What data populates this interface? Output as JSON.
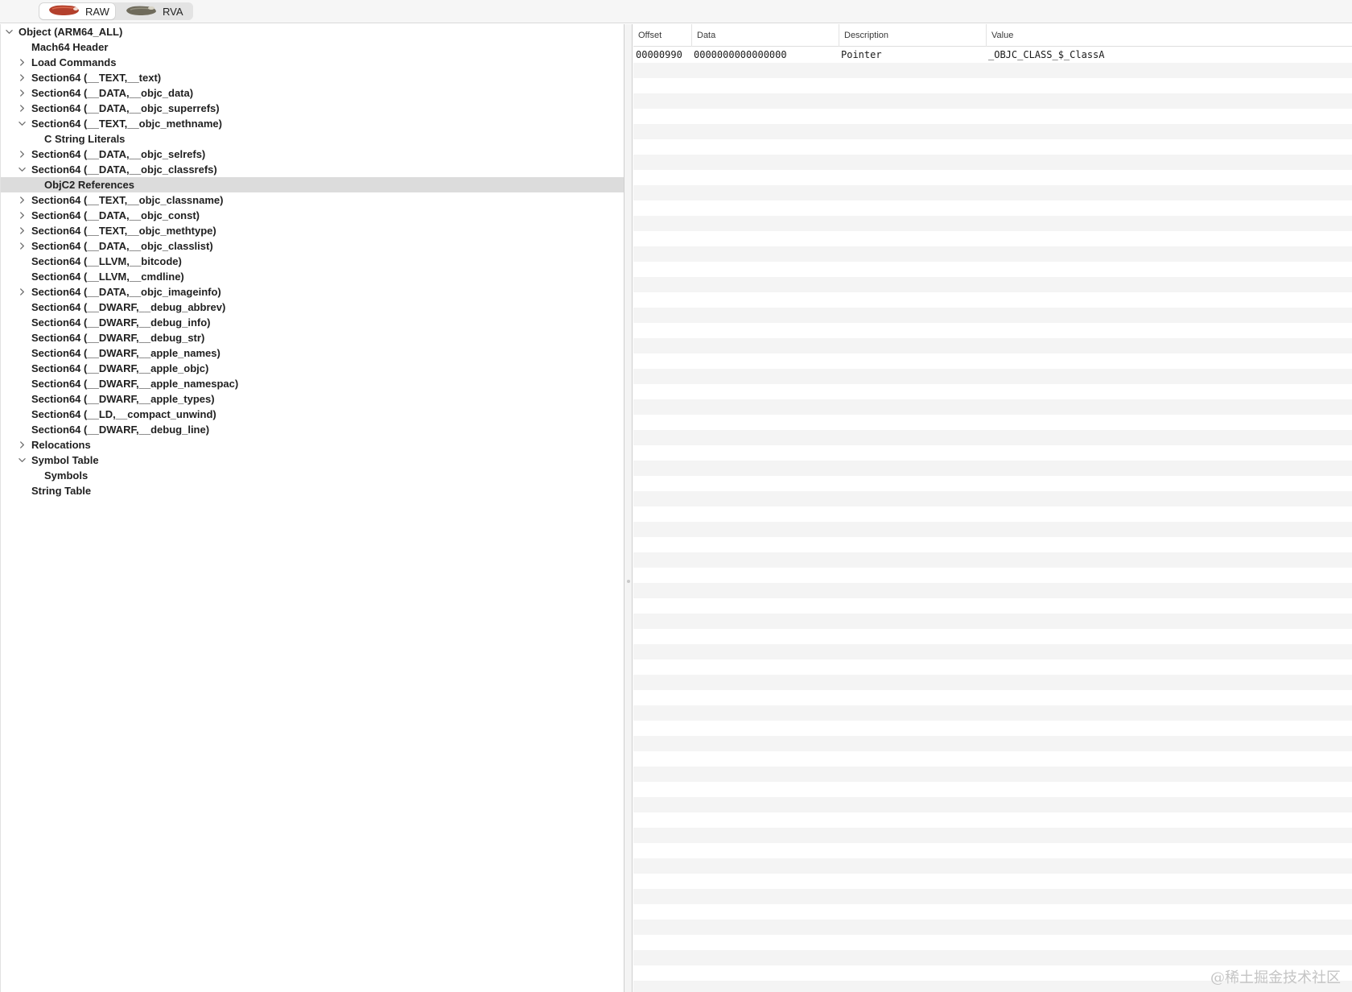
{
  "toolbar": {
    "segments": [
      {
        "label": "RAW",
        "active": true,
        "icon": "raw-icon"
      },
      {
        "label": "RVA",
        "active": false,
        "icon": "rva-icon"
      }
    ]
  },
  "tree": [
    {
      "label": "Object  (ARM64_ALL)",
      "depth": 0,
      "state": "expanded"
    },
    {
      "label": "Mach64 Header",
      "depth": 1,
      "state": "leaf"
    },
    {
      "label": "Load Commands",
      "depth": 1,
      "state": "collapsed"
    },
    {
      "label": "Section64 (__TEXT,__text)",
      "depth": 1,
      "state": "collapsed"
    },
    {
      "label": "Section64 (__DATA,__objc_data)",
      "depth": 1,
      "state": "collapsed"
    },
    {
      "label": "Section64 (__DATA,__objc_superrefs)",
      "depth": 1,
      "state": "collapsed"
    },
    {
      "label": "Section64 (__TEXT,__objc_methname)",
      "depth": 1,
      "state": "expanded"
    },
    {
      "label": "C String Literals",
      "depth": 2,
      "state": "leaf"
    },
    {
      "label": "Section64 (__DATA,__objc_selrefs)",
      "depth": 1,
      "state": "collapsed"
    },
    {
      "label": "Section64 (__DATA,__objc_classrefs)",
      "depth": 1,
      "state": "expanded"
    },
    {
      "label": "ObjC2 References",
      "depth": 2,
      "state": "leaf",
      "selected": true
    },
    {
      "label": "Section64 (__TEXT,__objc_classname)",
      "depth": 1,
      "state": "collapsed"
    },
    {
      "label": "Section64 (__DATA,__objc_const)",
      "depth": 1,
      "state": "collapsed"
    },
    {
      "label": "Section64 (__TEXT,__objc_methtype)",
      "depth": 1,
      "state": "collapsed"
    },
    {
      "label": "Section64 (__DATA,__objc_classlist)",
      "depth": 1,
      "state": "collapsed"
    },
    {
      "label": "Section64 (__LLVM,__bitcode)",
      "depth": 1,
      "state": "leaf"
    },
    {
      "label": "Section64 (__LLVM,__cmdline)",
      "depth": 1,
      "state": "leaf"
    },
    {
      "label": "Section64 (__DATA,__objc_imageinfo)",
      "depth": 1,
      "state": "collapsed"
    },
    {
      "label": "Section64 (__DWARF,__debug_abbrev)",
      "depth": 1,
      "state": "leaf"
    },
    {
      "label": "Section64 (__DWARF,__debug_info)",
      "depth": 1,
      "state": "leaf"
    },
    {
      "label": "Section64 (__DWARF,__debug_str)",
      "depth": 1,
      "state": "leaf"
    },
    {
      "label": "Section64 (__DWARF,__apple_names)",
      "depth": 1,
      "state": "leaf"
    },
    {
      "label": "Section64 (__DWARF,__apple_objc)",
      "depth": 1,
      "state": "leaf"
    },
    {
      "label": "Section64 (__DWARF,__apple_namespac)",
      "depth": 1,
      "state": "leaf"
    },
    {
      "label": "Section64 (__DWARF,__apple_types)",
      "depth": 1,
      "state": "leaf"
    },
    {
      "label": "Section64 (__LD,__compact_unwind)",
      "depth": 1,
      "state": "leaf"
    },
    {
      "label": "Section64 (__DWARF,__debug_line)",
      "depth": 1,
      "state": "leaf"
    },
    {
      "label": "Relocations",
      "depth": 1,
      "state": "collapsed"
    },
    {
      "label": "Symbol Table",
      "depth": 1,
      "state": "expanded"
    },
    {
      "label": "Symbols",
      "depth": 2,
      "state": "leaf"
    },
    {
      "label": "String Table",
      "depth": 1,
      "state": "leaf"
    }
  ],
  "table": {
    "columns": [
      "Offset",
      "Data",
      "Description",
      "Value"
    ],
    "rows": [
      {
        "offset": "00000990",
        "data": "0000000000000000",
        "description": "Pointer",
        "value": "_OBJC_CLASS_$_ClassA"
      }
    ]
  },
  "watermark": "@稀土掘金技术社区"
}
